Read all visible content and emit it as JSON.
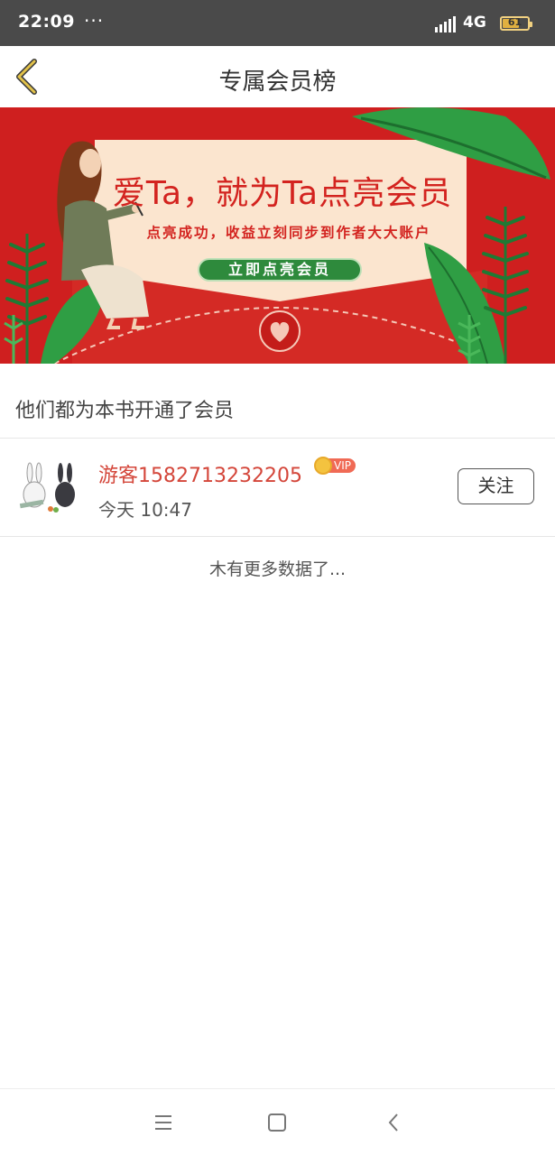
{
  "status_bar": {
    "time": "22:09",
    "dots": "···",
    "network": "4G",
    "battery": "61",
    "battery_level": 0.61,
    "icons": [
      "signal-icon",
      "battery-icon"
    ]
  },
  "header": {
    "title": "专属会员榜",
    "back_icon": "chevron-left-icon",
    "back_color": "#c9a227"
  },
  "banner": {
    "headline": "爱Ta，就为Ta点亮会员",
    "subtitle": "点亮成功，收益立刻同步到作者大大账户",
    "cta_label": "立即点亮会员",
    "colors": {
      "background": "#cf1f1f",
      "card": "#fbe5cf",
      "accent_green": "#2e8a3c",
      "text_red": "#d3231f"
    }
  },
  "section": {
    "title": "他们都为本书开通了会员"
  },
  "members": [
    {
      "name": "游客1582713232205",
      "vip_label": "VIP",
      "time": "今天 10:47",
      "follow_label": "关注",
      "name_color": "#d4463a"
    }
  ],
  "list_footer": "木有更多数据了...",
  "nav_bar": {
    "icons": [
      "menu-icon",
      "home-square-icon",
      "back-triangle-icon"
    ]
  }
}
